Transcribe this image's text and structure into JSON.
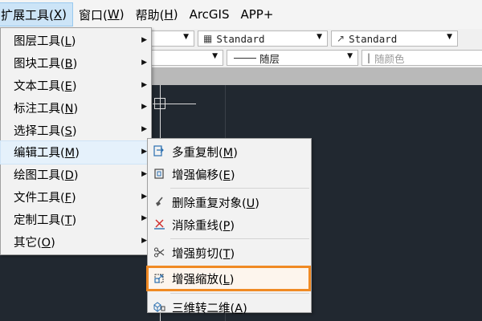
{
  "menubar": {
    "items": [
      {
        "label": "扩展工具(X)",
        "active": true
      },
      {
        "label": "窗口(W)"
      },
      {
        "label": "帮助(H)"
      },
      {
        "label": "ArcGIS"
      },
      {
        "label": "APP+"
      }
    ]
  },
  "toolbar": {
    "text_style": "Standard",
    "dim_style": "Standard",
    "linetype": "随层",
    "color": "随颜色"
  },
  "main_menu": {
    "items": [
      {
        "label": "图层工具(L)"
      },
      {
        "label": "图块工具(B)"
      },
      {
        "label": "文本工具(E)"
      },
      {
        "label": "标注工具(N)"
      },
      {
        "label": "选择工具(S)"
      },
      {
        "label": "编辑工具(M)",
        "highlighted": true
      },
      {
        "label": "绘图工具(D)"
      },
      {
        "label": "文件工具(F)"
      },
      {
        "label": "定制工具(T)"
      },
      {
        "label": "其它(O)"
      }
    ]
  },
  "sub_menu": {
    "items": [
      {
        "label": "多重复制(M)",
        "icon": "multi-copy-icon"
      },
      {
        "label": "增强偏移(E)",
        "icon": "offset-icon"
      },
      {
        "label": "删除重复对象(U)",
        "icon": "broom-icon"
      },
      {
        "label": "消除重线(P)",
        "icon": "x-line-icon"
      },
      {
        "label": "增强剪切(T)",
        "icon": "scissors-icon"
      },
      {
        "label": "增强缩放(L)",
        "icon": "scale-icon",
        "highlighted": true
      },
      {
        "label": "三维转二维(A)",
        "icon": "3d-to-2d-icon"
      }
    ]
  },
  "colors": {
    "canvas": "#212830",
    "highlight_box": "#f08a24",
    "menu_hover": "#e5f1fb"
  }
}
